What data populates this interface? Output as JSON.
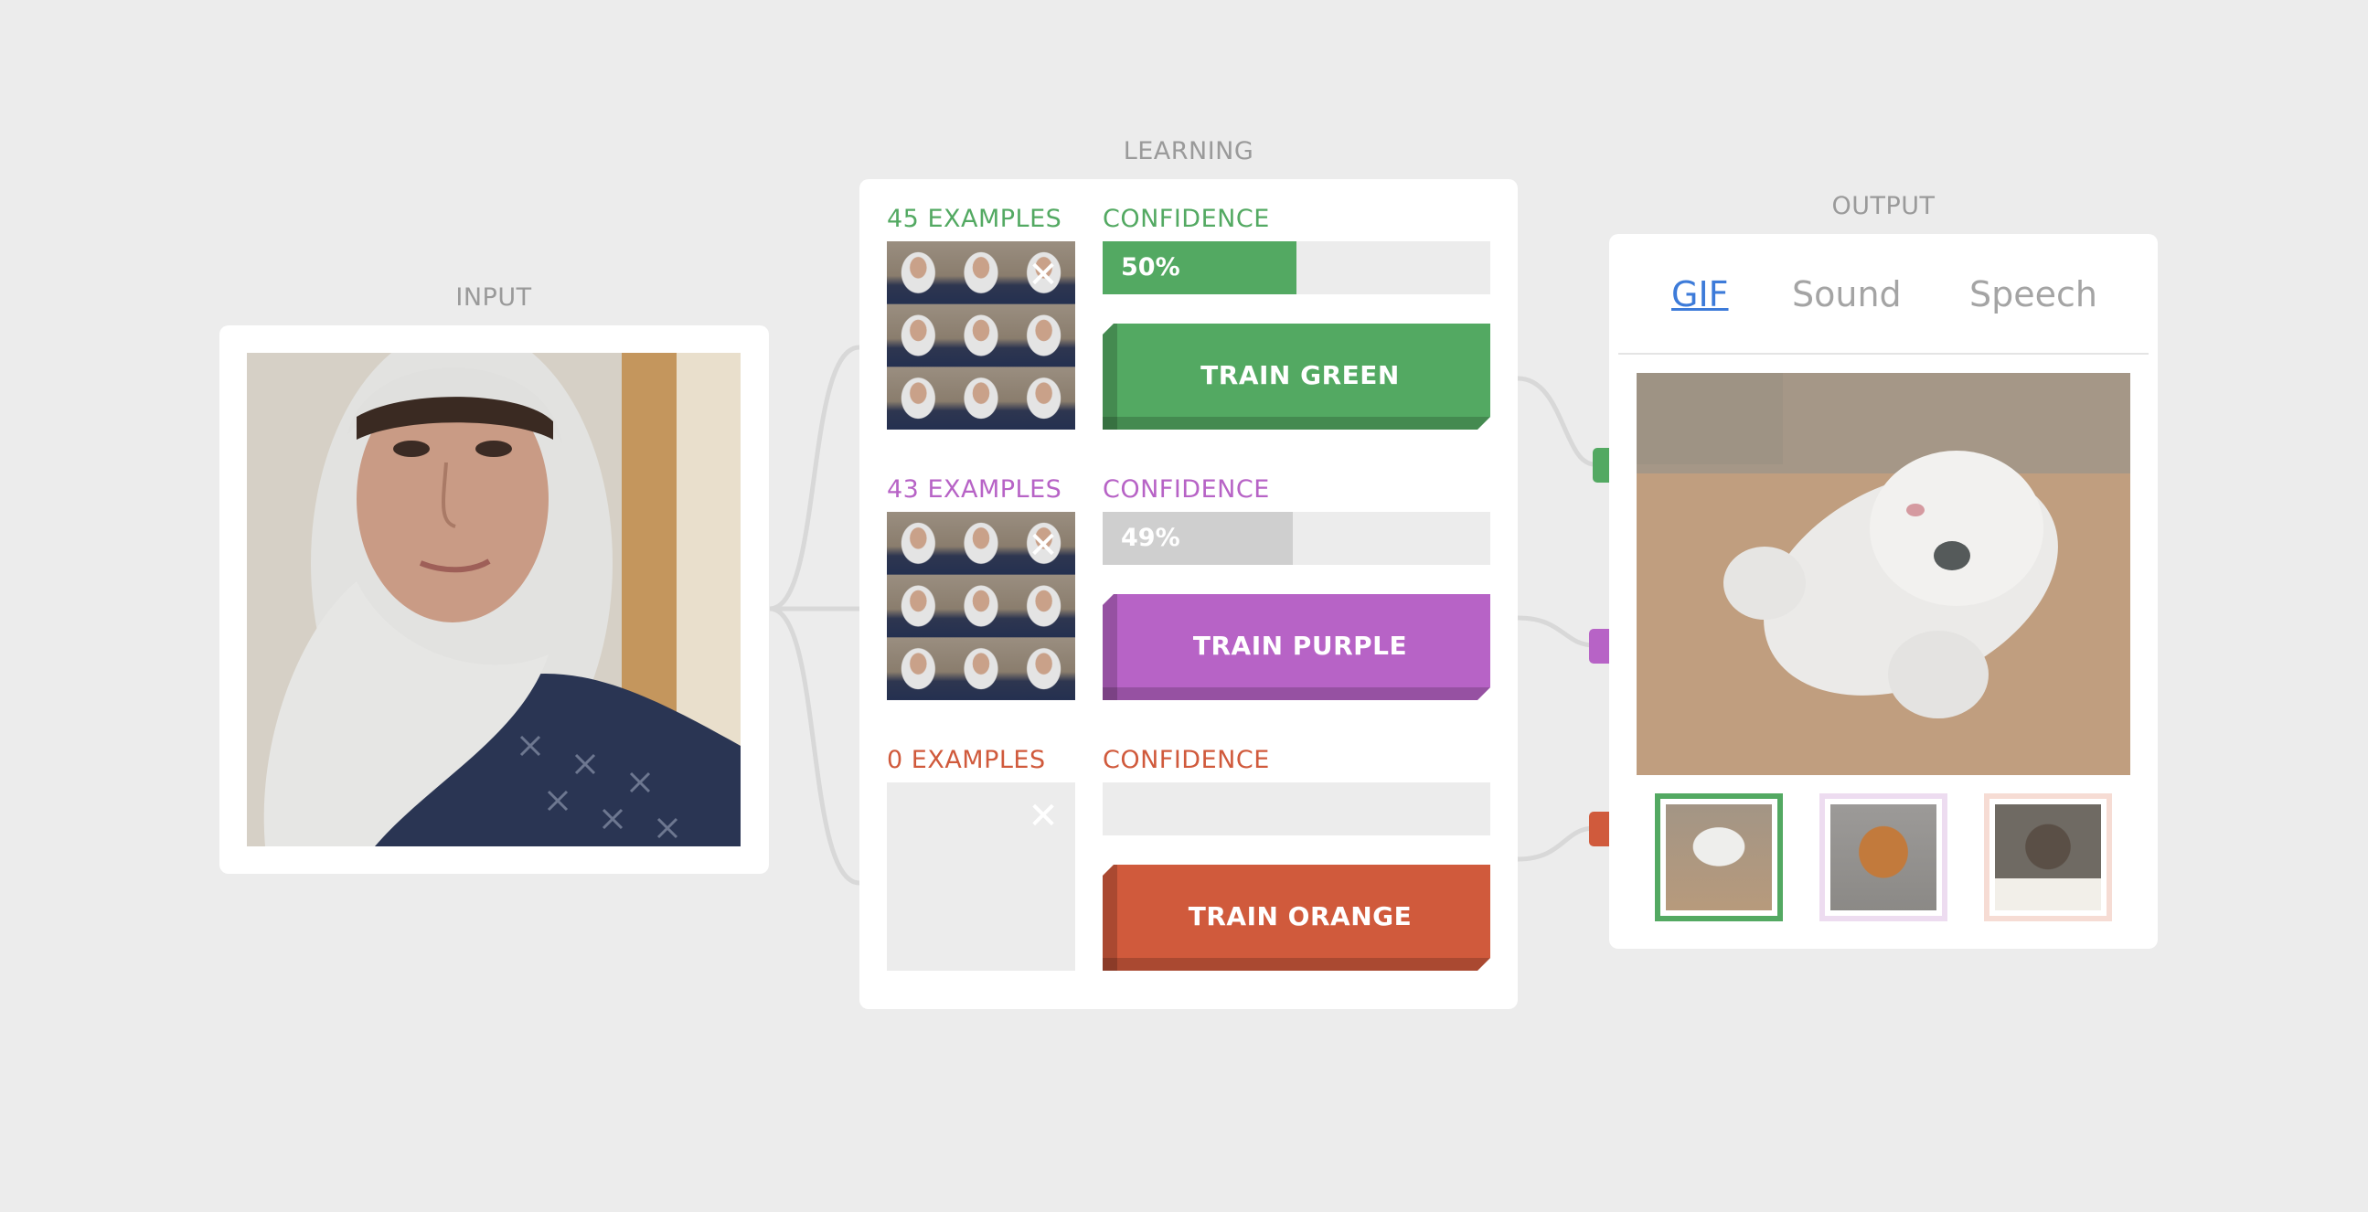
{
  "sections": {
    "input_title": "INPUT",
    "learning_title": "LEARNING",
    "output_title": "OUTPUT"
  },
  "colors": {
    "green": "#53a962",
    "purple": "#b763c6",
    "orange": "#d05a3c",
    "gray_fill": "#cfcfcf",
    "tab_active": "#3d7bd9"
  },
  "classes": [
    {
      "id": "green",
      "examples_label": "45 EXAMPLES",
      "confidence_label": "CONFIDENCE",
      "confidence": 0.5,
      "confidence_text": "50%",
      "button_label": "TRAIN GREEN",
      "close_icon": "close-icon",
      "has_examples": true
    },
    {
      "id": "purple",
      "examples_label": "43 EXAMPLES",
      "confidence_label": "CONFIDENCE",
      "confidence": 0.49,
      "confidence_text": "49%",
      "button_label": "TRAIN PURPLE",
      "close_icon": "close-icon",
      "has_examples": true
    },
    {
      "id": "orange",
      "examples_label": "0 EXAMPLES",
      "confidence_label": "CONFIDENCE",
      "confidence": 0,
      "confidence_text": "",
      "button_label": "TRAIN ORANGE",
      "close_icon": "close-icon",
      "has_examples": false
    }
  ],
  "output": {
    "tabs": [
      {
        "label": "GIF",
        "active": true
      },
      {
        "label": "Sound",
        "active": false
      },
      {
        "label": "Speech",
        "active": false
      }
    ],
    "selected_gif": 0,
    "gif_thumbnails": [
      {
        "name": "white-cat",
        "border_color": "#53a962",
        "active": true
      },
      {
        "name": "orange-dog",
        "border_color": "#eddcf0",
        "active": false
      },
      {
        "name": "tabby-cat",
        "border_color": "#f6dcd4",
        "active": false
      }
    ]
  }
}
